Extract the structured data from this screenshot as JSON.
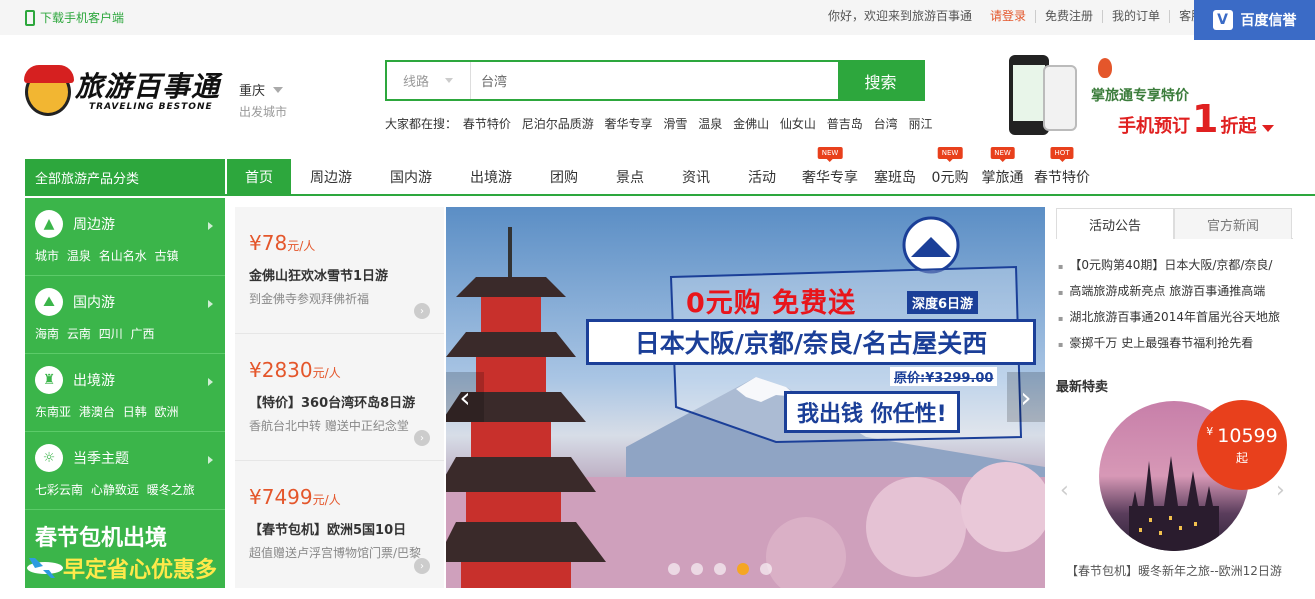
{
  "topbar": {
    "mobile_link": "下载手机客户端",
    "greeting": "你好，欢迎来到旅游百事通",
    "login": "请登录",
    "register": "免费注册",
    "orders": "我的订单",
    "service": "客服",
    "baidu_badge": "百度信誉"
  },
  "header": {
    "logo_cn": "旅游百事通",
    "logo_en": "TRAVELING BESTONE",
    "city": "重庆",
    "city_sub": "出发城市",
    "search_type": "线路",
    "search_value": "台湾",
    "search_button": "搜索",
    "hot_label": "大家都在搜：",
    "hot_terms": [
      "春节特价",
      "尼泊尔品质游",
      "奢华专享",
      "滑雪",
      "温泉",
      "金佛山",
      "仙女山",
      "普吉岛",
      "台湾",
      "丽江"
    ],
    "promo_line1": "掌旅通专享特价",
    "promo_line2a": "手机预订",
    "promo_line2b": "1",
    "promo_line2c": "折起"
  },
  "nav": {
    "all_categories": "全部旅游产品分类",
    "items": [
      {
        "label": "首页",
        "badge": ""
      },
      {
        "label": "周边游",
        "badge": ""
      },
      {
        "label": "国内游",
        "badge": ""
      },
      {
        "label": "出境游",
        "badge": ""
      },
      {
        "label": "团购",
        "badge": ""
      },
      {
        "label": "景点",
        "badge": ""
      },
      {
        "label": "资讯",
        "badge": ""
      },
      {
        "label": "活动",
        "badge": ""
      },
      {
        "label": "奢华专享",
        "badge": "NEW"
      },
      {
        "label": "塞班岛",
        "badge": ""
      },
      {
        "label": "0元购",
        "badge": "NEW"
      },
      {
        "label": "掌旅通",
        "badge": "NEW"
      },
      {
        "label": "春节特价",
        "badge": "HOT"
      }
    ]
  },
  "sidebar": {
    "categories": [
      {
        "title": "周边游",
        "icon": "mountain-icon",
        "subs": [
          "城市",
          "温泉",
          "名山名水",
          "古镇"
        ]
      },
      {
        "title": "国内游",
        "icon": "peaks-icon",
        "subs": [
          "海南",
          "云南",
          "四川",
          "广西"
        ]
      },
      {
        "title": "出境游",
        "icon": "tower-icon",
        "subs": [
          "东南亚",
          "港澳台",
          "日韩",
          "欧洲"
        ]
      },
      {
        "title": "当季主题",
        "icon": "palm-icon",
        "subs": [
          "七彩云南",
          "心静致远",
          "暖冬之旅"
        ]
      }
    ],
    "banner_line1": "春节包机出境",
    "banner_line2": "早定省心优惠多"
  },
  "deals": [
    {
      "price": "¥78",
      "unit": "元/人",
      "name": "金佛山狂欢冰雪节1日游",
      "desc": "到金佛寺参观拜佛祈福"
    },
    {
      "price": "¥2830",
      "unit": "元/人",
      "name": "【特价】360台湾环岛8日游",
      "desc": "香航台北中转 赠送中正纪念堂"
    },
    {
      "price": "¥7499",
      "unit": "元/人",
      "name": "【春节包机】欧洲5国10日",
      "desc": "超值赠送卢浮宫博物馆门票/巴黎"
    }
  ],
  "hero": {
    "headline": "0元购 免费送",
    "tag": "深度6日游",
    "destination": "日本大阪/京都/奈良/名古屋关西",
    "original_price": "原价:¥3299.00",
    "slogan": "我出钱 你任性!",
    "slide_count": 5,
    "active_slide": 3
  },
  "right": {
    "tabs": [
      "活动公告",
      "官方新闻"
    ],
    "news": [
      "【0元购第40期】日本大阪/京都/奈良/",
      "高端旅游成新亮点 旅游百事通推高端",
      "湖北旅游百事通2014年首届光谷天地旅",
      "豪掷千万 史上最强春节福利抢先看"
    ],
    "special_title": "最新特卖",
    "special_price_symbol": "¥",
    "special_price": "10599",
    "special_price_suffix": "起",
    "special_name": "【春节包机】暖冬新年之旅--欧洲12日游"
  }
}
